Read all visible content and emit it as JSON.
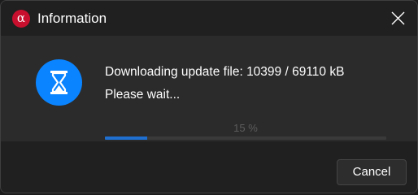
{
  "window": {
    "title": "Information",
    "app_icon": {
      "name": "alpha-icon",
      "glyph": "α",
      "color": "#c8102e"
    },
    "close_icon": "close-icon"
  },
  "dialog": {
    "icon": {
      "name": "hourglass-icon",
      "color": "#0a84ff"
    },
    "message_line1": "Downloading update file: 10399 / 69110 kB",
    "message_line2": "Please wait...",
    "progress": {
      "label": "15 %",
      "fraction": 0.15,
      "fill_color": "#1f6fd1"
    }
  },
  "footer": {
    "cancel_label": "Cancel"
  }
}
